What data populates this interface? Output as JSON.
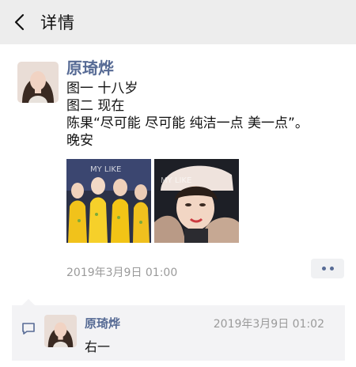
{
  "nav": {
    "title": "详情",
    "back_icon": "chevron-left-icon"
  },
  "post": {
    "author": "原琦烨",
    "lines": [
      "图一 十八岁",
      "图二 现在",
      "陈果“尽可能 尽可能 纯洁一点 美一点”。",
      "晚安"
    ],
    "timestamp": "2019年3月9日 01:00",
    "more_icon": "more-dots-icon",
    "photo_watermark": "MY LIKE"
  },
  "comment": {
    "icon": "comment-bubble-icon",
    "author": "原琦烨",
    "time": "2019年3月9日 01:02",
    "text": "右一"
  },
  "colors": {
    "link_blue": "#576b95",
    "nav_bg": "#ededed",
    "comment_bg": "#f3f3f5",
    "muted": "#9a9a9a"
  }
}
